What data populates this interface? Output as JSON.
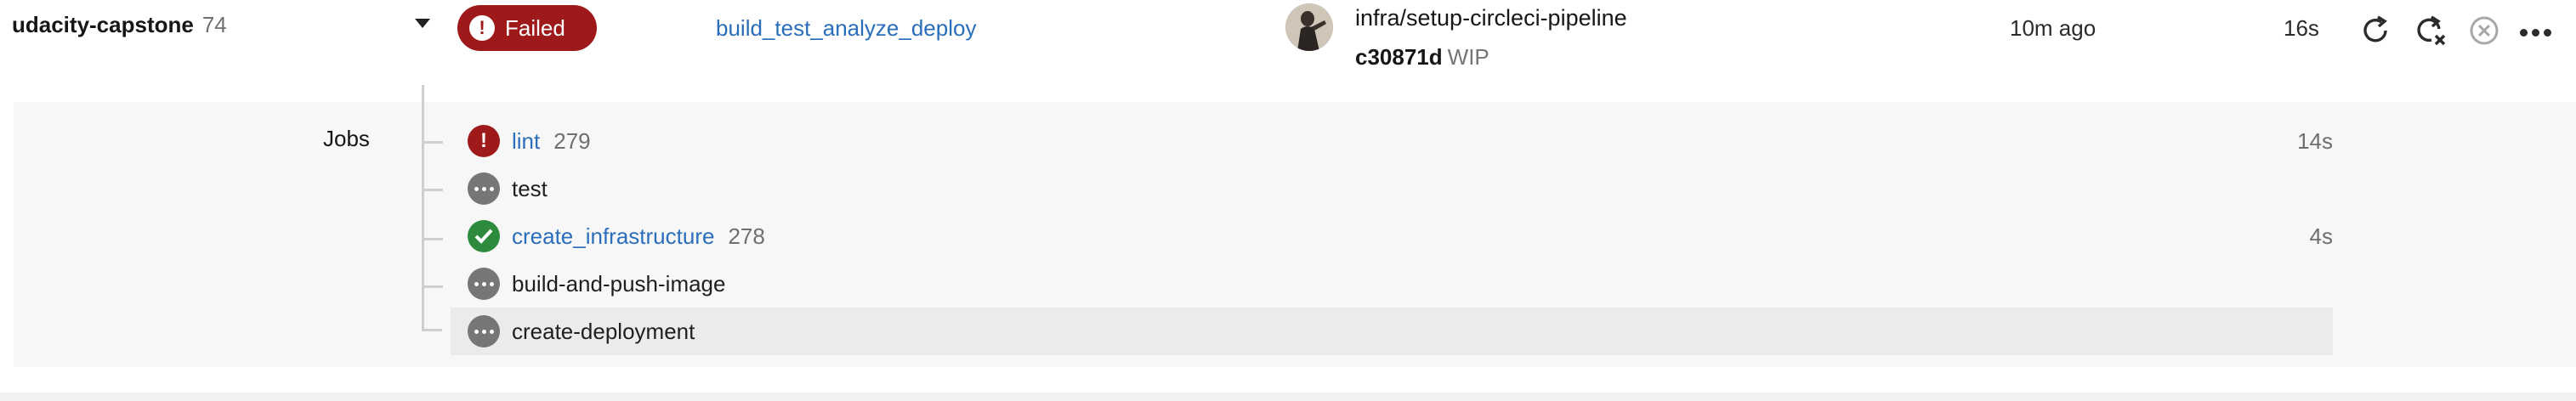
{
  "pipeline": {
    "project": "udacity-capstone",
    "number": "74",
    "status": "Failed",
    "workflow": "build_test_analyze_deploy",
    "branch": "infra/setup-circleci-pipeline",
    "commit_sha": "c30871d",
    "commit_msg": "WIP",
    "time_ago": "10m ago",
    "duration": "16s",
    "actions": [
      "rerun-icon",
      "rerun-failed-icon",
      "cancel-icon",
      "more-icon"
    ]
  },
  "jobs": {
    "label": "Jobs",
    "rows": [
      {
        "name": "lint",
        "number": "279",
        "duration": "14s",
        "status": "failed"
      },
      {
        "name": "test",
        "number": "",
        "duration": "",
        "status": "pending"
      },
      {
        "name": "create_infrastructure",
        "number": "278",
        "duration": "4s",
        "status": "success"
      },
      {
        "name": "build-and-push-image",
        "number": "",
        "duration": "",
        "status": "pending"
      },
      {
        "name": "create-deployment",
        "number": "",
        "duration": "",
        "status": "pending"
      }
    ]
  },
  "colors": {
    "failed": "#9e1a1a",
    "success": "#2e8b3e",
    "pending": "#767676",
    "link": "#2a6ebb"
  }
}
